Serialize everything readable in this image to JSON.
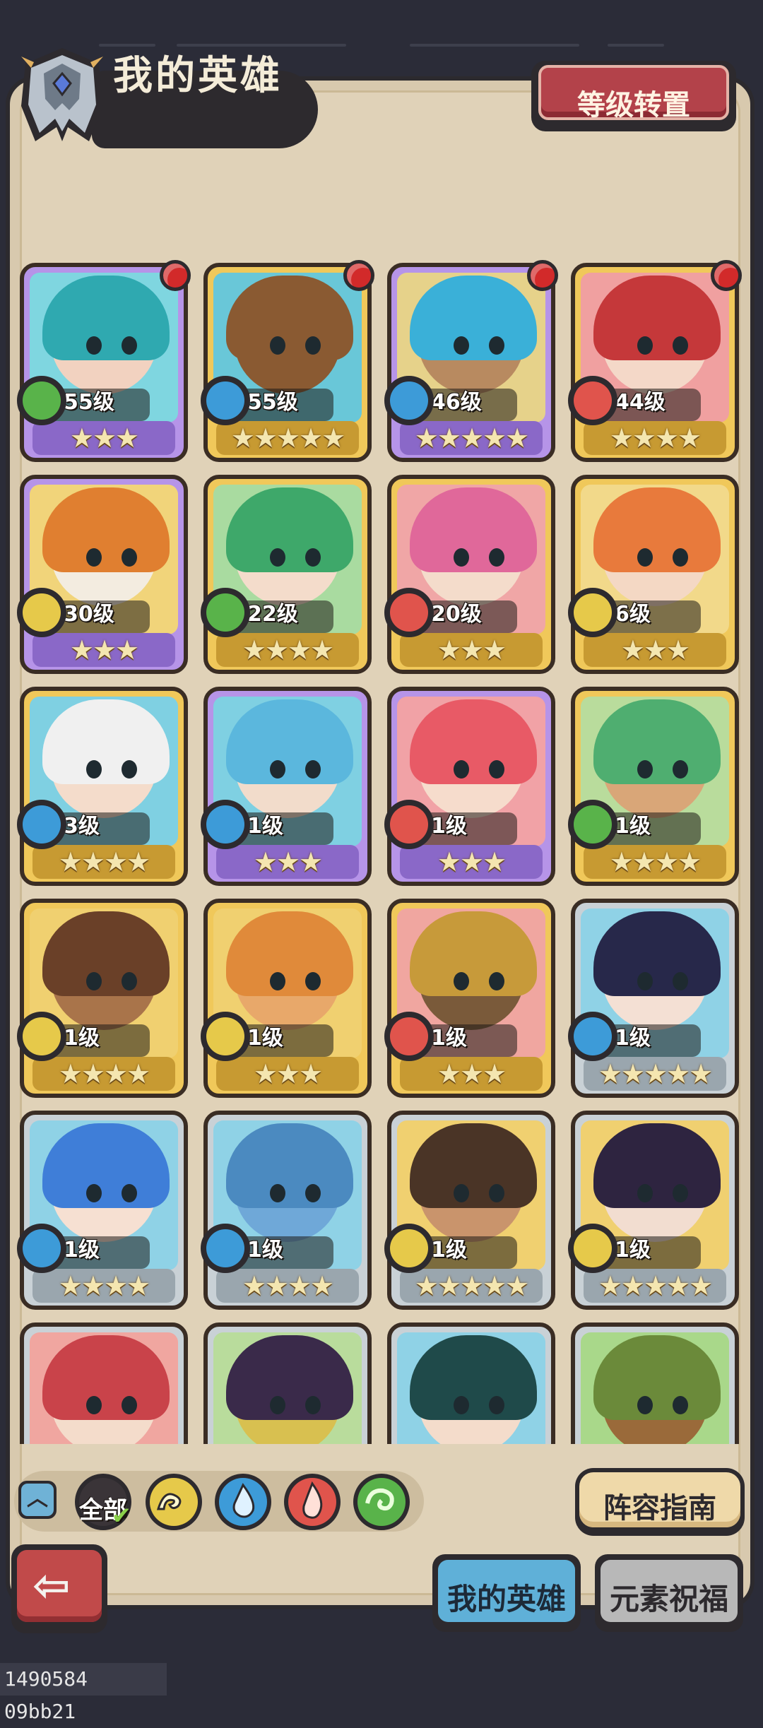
{
  "header": {
    "title": "我的英雄",
    "level_transfer_button": "等级转置"
  },
  "colors": {
    "panel": "#e0d2b8",
    "frame_dark": "#2d2a2e",
    "rarity_purple": "#b694e8",
    "rarity_gold": "#f0c85a",
    "rarity_silver": "#c9d1d6",
    "element_water": "#3d9bd8",
    "element_fire": "#e0544c",
    "element_earth": "#e6c94a",
    "element_wind": "#59b34a",
    "notification_red": "#d22a2a"
  },
  "heroes": [
    {
      "level": "55级",
      "stars": "★★★",
      "rarity": "purple",
      "element": "wind",
      "badge": true,
      "hair": "#2fa9b0",
      "skin": "#f2d2c0",
      "bg": "#7fd6e0"
    },
    {
      "level": "55级",
      "stars": "★★★★★",
      "rarity": "gold",
      "element": "water",
      "badge": true,
      "hair": "#8a5a32",
      "skin": "#8a5a32",
      "bg": "#69c7d8"
    },
    {
      "level": "46级",
      "stars": "★★★★★",
      "rarity": "purple",
      "element": "water",
      "badge": true,
      "hair": "#3ab0d8",
      "skin": "#b88a60",
      "bg": "#e6d28a"
    },
    {
      "level": "44级",
      "stars": "★★★★",
      "rarity": "gold",
      "element": "fire",
      "badge": true,
      "hair": "#c5383a",
      "skin": "#f4d8c8",
      "bg": "#f0a0a0"
    },
    {
      "level": "30级",
      "stars": "★★★",
      "rarity": "purple",
      "element": "earth",
      "badge": false,
      "hair": "#e07f30",
      "skin": "#f3ece0",
      "bg": "#f1d47a"
    },
    {
      "level": "22级",
      "stars": "★★★★",
      "rarity": "gold",
      "element": "wind",
      "badge": false,
      "hair": "#3ea86a",
      "skin": "#f4dccb",
      "bg": "#a9dba0"
    },
    {
      "level": "20级",
      "stars": "★★★",
      "rarity": "gold",
      "element": "fire",
      "badge": false,
      "hair": "#e0689a",
      "skin": "#f4dccb",
      "bg": "#f0a6a6"
    },
    {
      "level": "6级",
      "stars": "★★★",
      "rarity": "gold",
      "element": "earth",
      "badge": false,
      "hair": "#e87a3c",
      "skin": "#f4d8c4",
      "bg": "#f2d98a"
    },
    {
      "level": "3级",
      "stars": "★★★★",
      "rarity": "gold",
      "element": "water",
      "badge": false,
      "hair": "#f0f0f0",
      "skin": "#f4dccb",
      "bg": "#7fd0e2"
    },
    {
      "level": "1级",
      "stars": "★★★",
      "rarity": "purple",
      "element": "water",
      "badge": false,
      "hair": "#5bb7dd",
      "skin": "#f2dccb",
      "bg": "#7fd0e2"
    },
    {
      "level": "1级",
      "stars": "★★★",
      "rarity": "purple",
      "element": "fire",
      "badge": false,
      "hair": "#e85a66",
      "skin": "#f6dccc",
      "bg": "#f1a2a6"
    },
    {
      "level": "1级",
      "stars": "★★★★",
      "rarity": "gold",
      "element": "wind",
      "badge": false,
      "hair": "#4fae70",
      "skin": "#d9a678",
      "bg": "#b9dc9c"
    },
    {
      "level": "1级",
      "stars": "★★★★",
      "rarity": "gold",
      "element": "earth",
      "badge": false,
      "hair": "#6a4028",
      "skin": "#a9744a",
      "bg": "#f0d070"
    },
    {
      "level": "1级",
      "stars": "★★★",
      "rarity": "gold",
      "element": "earth",
      "badge": false,
      "hair": "#e08a3a",
      "skin": "#e8a86a",
      "bg": "#f0d070"
    },
    {
      "level": "1级",
      "stars": "★★★",
      "rarity": "gold",
      "element": "fire",
      "badge": false,
      "hair": "#c79a3a",
      "skin": "#7a5a3a",
      "bg": "#f0a6a0"
    },
    {
      "level": "1级",
      "stars": "★★★★★",
      "rarity": "silver",
      "element": "water",
      "badge": false,
      "hair": "#27284a",
      "skin": "#f4e0d4",
      "bg": "#8fd2e6"
    },
    {
      "level": "1级",
      "stars": "★★★★",
      "rarity": "silver",
      "element": "water",
      "badge": false,
      "hair": "#3f7ed8",
      "skin": "#f6e0d2",
      "bg": "#8fd2e6"
    },
    {
      "level": "1级",
      "stars": "★★★★",
      "rarity": "silver",
      "element": "water",
      "badge": false,
      "hair": "#4b8ac0",
      "skin": "#6fa8d8",
      "bg": "#8fd2e6"
    },
    {
      "level": "1级",
      "stars": "★★★★★",
      "rarity": "silver",
      "element": "earth",
      "badge": false,
      "hair": "#4a3426",
      "skin": "#c9946c",
      "bg": "#f0d070"
    },
    {
      "level": "1级",
      "stars": "★★★★★",
      "rarity": "silver",
      "element": "earth",
      "badge": false,
      "hair": "#2e2440",
      "skin": "#f2ddd0",
      "bg": "#f0d070"
    },
    {
      "level": "",
      "stars": "",
      "rarity": "silver",
      "element": "",
      "badge": false,
      "hair": "#c9434a",
      "skin": "#f4dccb",
      "bg": "#f0a6a0"
    },
    {
      "level": "",
      "stars": "",
      "rarity": "silver",
      "element": "",
      "badge": false,
      "hair": "#3a2a4a",
      "skin": "#d8c050",
      "bg": "#b9dc9c"
    },
    {
      "level": "",
      "stars": "",
      "rarity": "silver",
      "element": "",
      "badge": false,
      "hair": "#1f4a4a",
      "skin": "#f4dccb",
      "bg": "#8fd2e6"
    },
    {
      "level": "",
      "stars": "",
      "rarity": "silver",
      "element": "",
      "badge": false,
      "hair": "#6b8a3a",
      "skin": "#9a6a3a",
      "bg": "#a9d88a"
    }
  ],
  "filters": {
    "all_label": "全部",
    "elements": [
      "earth-icon",
      "water-icon",
      "fire-icon",
      "wind-icon"
    ]
  },
  "footer": {
    "guide_button": "阵容指南",
    "tab_my_heroes": "我的英雄",
    "tab_element_blessing": "元素祝福",
    "build_id": "1490584 09bb21"
  }
}
